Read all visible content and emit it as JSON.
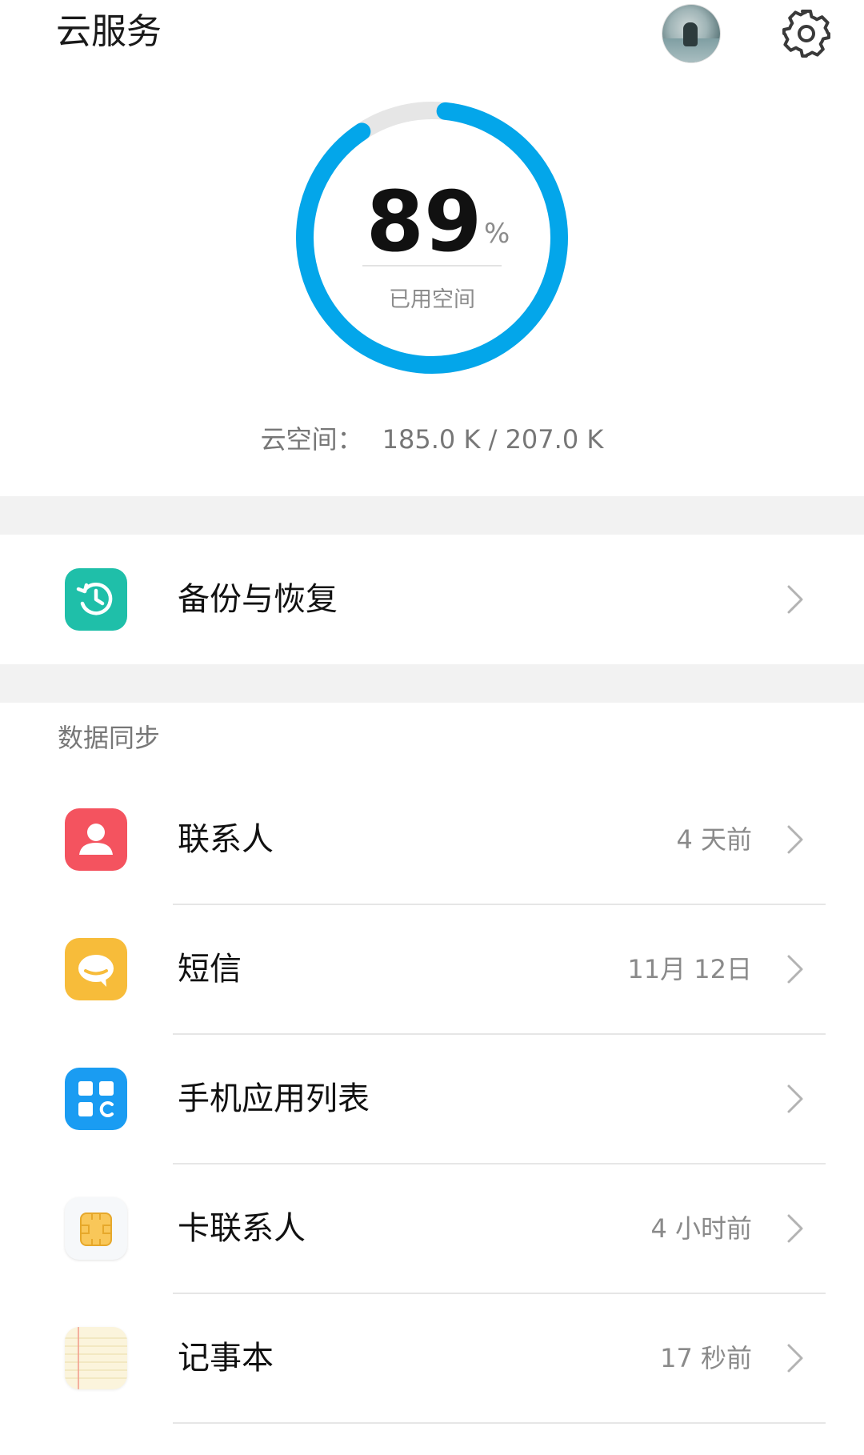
{
  "header": {
    "title": "云服务"
  },
  "storage": {
    "percent": "89",
    "percent_value": 89,
    "percent_sign": "%",
    "used_label": "已用空间",
    "cloud_label": "云空间：",
    "cloud_value": "185.0 K / 207.0 K",
    "ring_color": "#03a6ea",
    "track_color": "#e6e6e6"
  },
  "backup": {
    "label": "备份与恢复",
    "icon": "clock-restore-icon",
    "color": "#1fbfa9"
  },
  "sync": {
    "section_title": "数据同步",
    "items": [
      {
        "label": "联系人",
        "meta": "4 天前",
        "icon": "contacts-icon",
        "color": "#f4535f"
      },
      {
        "label": "短信",
        "meta": "11月 12日",
        "icon": "message-icon",
        "color": "#f7bc3a"
      },
      {
        "label": "手机应用列表",
        "meta": "",
        "icon": "app-list-icon",
        "color": "#1a9cf2"
      },
      {
        "label": "卡联系人",
        "meta": "4 小时前",
        "icon": "sim-card-icon",
        "color": "#f9c759"
      },
      {
        "label": "记事本",
        "meta": "17 秒前",
        "icon": "notepad-icon",
        "color": "#fbf4dc"
      }
    ]
  }
}
